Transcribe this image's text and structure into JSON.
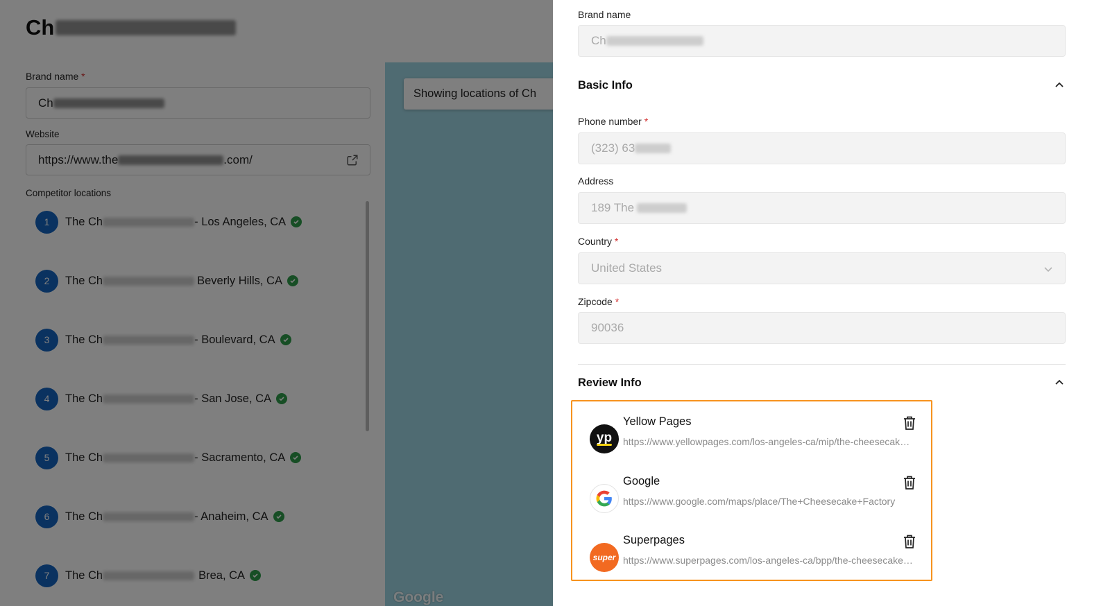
{
  "background": {
    "title_prefix": "Ch",
    "brand_label": "Brand name",
    "required_mark": "*",
    "brand_value_prefix": "Ch",
    "website_label": "Website",
    "website_value_start": "https://www.the",
    "website_value_end": ".com/",
    "competitor_label": "Competitor locations",
    "locations": [
      {
        "num": "1",
        "prefix": "The Ch",
        "suffix": "- Los Angeles, CA"
      },
      {
        "num": "2",
        "prefix": "The Ch",
        "suffix": "Beverly Hills, CA"
      },
      {
        "num": "3",
        "prefix": "The Ch",
        "suffix": "- Boulevard, CA"
      },
      {
        "num": "4",
        "prefix": "The Ch",
        "suffix": "- San Jose, CA"
      },
      {
        "num": "5",
        "prefix": "The Ch",
        "suffix": "- Sacramento, CA"
      },
      {
        "num": "6",
        "prefix": "The Ch",
        "suffix": "- Anaheim, CA"
      },
      {
        "num": "7",
        "prefix": "The Ch",
        "suffix": "Brea, CA"
      }
    ],
    "map_chip_text": "Showing locations of Ch",
    "map_watermark": "Google"
  },
  "drawer": {
    "brand_label": "Brand name",
    "brand_value_prefix": "Ch",
    "basic_info_title": "Basic Info",
    "phone_label": "Phone number",
    "phone_value_prefix": "(323) 63",
    "address_label": "Address",
    "address_value_prefix": "189 The",
    "country_label": "Country",
    "country_value": "United States",
    "zipcode_label": "Zipcode",
    "zipcode_value": "90036",
    "review_info_title": "Review Info",
    "reviews": [
      {
        "name": "Yellow Pages",
        "url": "https://www.yellowpages.com/los-angeles-ca/mip/the-cheesecake-factory",
        "logo": "yp-logo-icon"
      },
      {
        "name": "Google",
        "url": "https://www.google.com/maps/place/The+Cheesecake+Factory",
        "logo": "google-logo-icon"
      },
      {
        "name": "Superpages",
        "url": "https://www.superpages.com/los-angeles-ca/bpp/the-cheesecake-factory",
        "logo": "superpages-logo-icon"
      }
    ],
    "yp_logo_text": "yp",
    "super_logo_text": "super"
  },
  "colors": {
    "accent_blue": "#1565c0",
    "success_green": "#2e9d4a",
    "highlight_orange": "#f7931e",
    "required_red": "#d32f2f"
  }
}
